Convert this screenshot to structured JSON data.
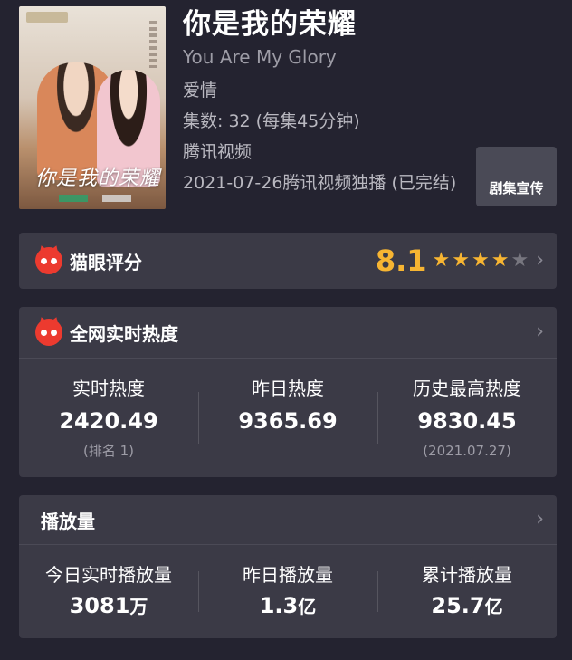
{
  "header": {
    "poster_title": "你是我的荣耀",
    "title": "你是我的荣耀",
    "en_title": "You Are My Glory",
    "genre": "爱情",
    "episodes": "集数: 32  (每集45分钟)",
    "platform": "腾讯视频",
    "release": "2021-07-26腾讯视频独播 (已完结)",
    "promo_button": "剧集宣传"
  },
  "rating": {
    "label": "猫眼评分",
    "value": "8.1",
    "stars": [
      "★",
      "★",
      "★",
      "★",
      "★"
    ],
    "star_fill": 0.81,
    "chevron": "›"
  },
  "heat": {
    "label": "全网实时热度",
    "chevron": "›",
    "stats": [
      {
        "label": "实时热度",
        "value": "2420.49",
        "sub": "(排名 1)"
      },
      {
        "label": "昨日热度",
        "value": "9365.69",
        "sub": ""
      },
      {
        "label": "历史最高热度",
        "value": "9830.45",
        "sub": "(2021.07.27)"
      }
    ]
  },
  "plays": {
    "label": "播放量",
    "chevron": "›",
    "stats": [
      {
        "label": "今日实时播放量",
        "value": "3081",
        "unit": "万"
      },
      {
        "label": "昨日播放量",
        "value": "1.3",
        "unit": "亿"
      },
      {
        "label": "累计播放量",
        "value": "25.7",
        "unit": "亿"
      }
    ]
  },
  "colors": {
    "background": "#242330",
    "card": "#3b3a46",
    "accent_gold": "#f7b532",
    "maoyan_red": "#ec3a2f"
  }
}
